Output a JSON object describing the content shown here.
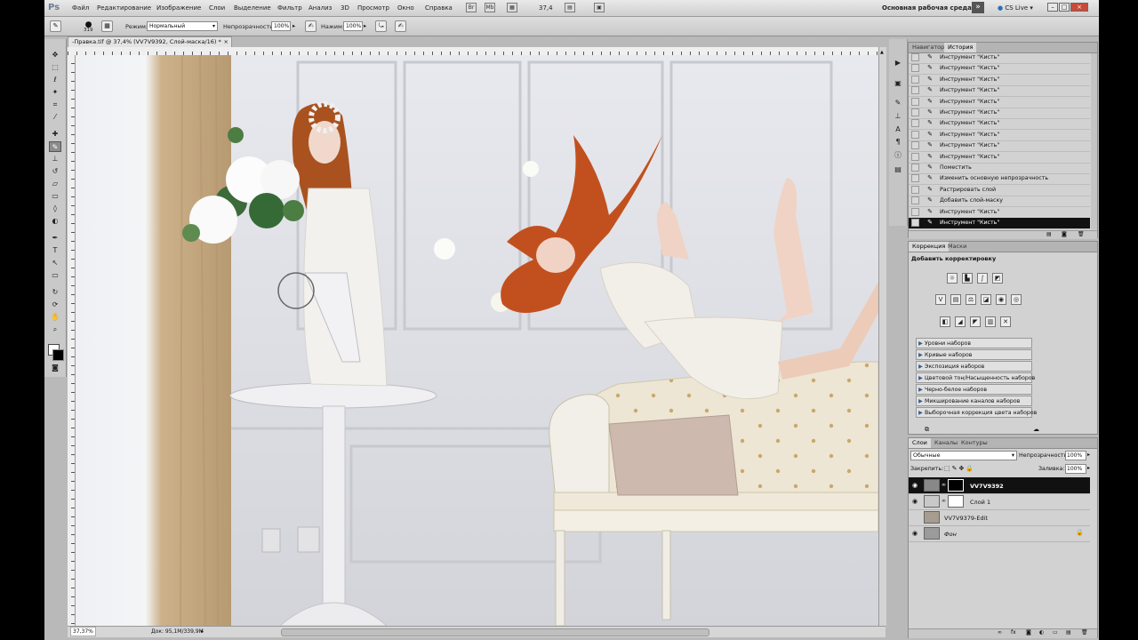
{
  "app": {
    "logo": "Ps"
  },
  "menu": [
    "Файл",
    "Редактирование",
    "Изображение",
    "Слои",
    "Выделение",
    "Фильтр",
    "Анализ",
    "3D",
    "Просмотр",
    "Окно",
    "Справка"
  ],
  "zoom_value": "37,4",
  "workspace": {
    "label": "Основная рабочая среда",
    "cslive": "CS Live"
  },
  "window_buttons": [
    "–",
    "□",
    "×"
  ],
  "options": {
    "brush_size": "319",
    "mode_label": "Режим:",
    "mode_value": "Нормальный",
    "opacity_label": "Непрозрачность:",
    "opacity_value": "100%",
    "flow_label": "Нажим:",
    "flow_value": "100%"
  },
  "document": {
    "tab": "-Правка.tif @ 37,4% (VV7V9392, Слой-маска/16) *",
    "tab_close": "×",
    "status_zoom": "37,37%",
    "status_doc": "Док: 95,1M/339,9M"
  },
  "history": {
    "tabs": [
      "Навигатор",
      "История"
    ],
    "items": [
      "Инструмент \"Кисть\"",
      "Инструмент \"Кисть\"",
      "Инструмент \"Кисть\"",
      "Инструмент \"Кисть\"",
      "Инструмент \"Кисть\"",
      "Инструмент \"Кисть\"",
      "Инструмент \"Кисть\"",
      "Инструмент \"Кисть\"",
      "Инструмент \"Кисть\"",
      "Инструмент \"Кисть\"",
      "Поместить",
      "Изменить основную непрозрачность",
      "Растрировать слой",
      "Добавить слой-маску",
      "Инструмент \"Кисть\"",
      "Инструмент \"Кисть\""
    ]
  },
  "adjustments": {
    "tabs": [
      "Коррекция",
      "Маски"
    ],
    "title": "Добавить корректировку",
    "presets": [
      "Уровни наборов",
      "Кривые наборов",
      "Экспозиция наборов",
      "Цветовой тон/Насыщенность наборов",
      "Черно-белое наборов",
      "Микширование каналов наборов",
      "Выборочная коррекция цвета наборов"
    ]
  },
  "layers": {
    "tabs": [
      "Слои",
      "Каналы",
      "Контуры"
    ],
    "blend_mode": "Обычные",
    "opacity_label": "Непрозрачность:",
    "opacity_value": "100%",
    "lock_label": "Закрепить:",
    "fill_label": "Заливка:",
    "fill_value": "100%",
    "items": [
      {
        "name": "VV7V9392"
      },
      {
        "name": "Слой 1"
      },
      {
        "name": "VV7V9379-Edit"
      },
      {
        "name": "Фон"
      }
    ]
  },
  "colors": {
    "hair": "#c2501f",
    "wall": "#dcdde3",
    "curtain": "#c9ad86"
  }
}
